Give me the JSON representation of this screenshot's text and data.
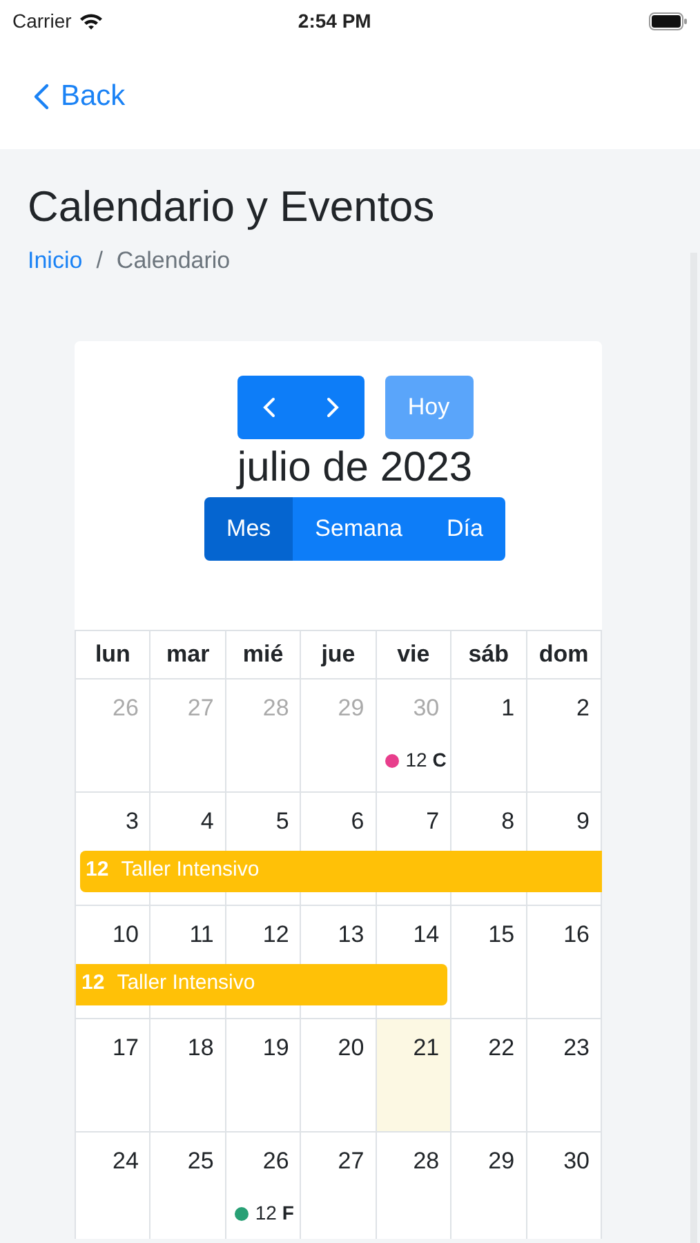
{
  "status_bar": {
    "carrier": "Carrier",
    "time": "2:54 PM"
  },
  "nav": {
    "back": "Back"
  },
  "page": {
    "title": "Calendario y Eventos",
    "breadcrumb": {
      "separator": "/",
      "items": [
        {
          "label": "Inicio",
          "kind": "link"
        },
        {
          "label": "Calendario",
          "kind": "current"
        }
      ]
    }
  },
  "calendar": {
    "title": "julio de 2023",
    "today_button": {
      "label": "Hoy",
      "disabled": true
    },
    "views": [
      {
        "label": "Mes",
        "selected": true
      },
      {
        "label": "Semana",
        "selected": false
      },
      {
        "label": "Día",
        "selected": false
      }
    ],
    "weekdays": [
      "lun",
      "mar",
      "mié",
      "jue",
      "vie",
      "sáb",
      "dom"
    ],
    "weeks": [
      {
        "days": [
          {
            "label": "26",
            "muted": true,
            "today": false
          },
          {
            "label": "27",
            "muted": true,
            "today": false
          },
          {
            "label": "28",
            "muted": true,
            "today": false
          },
          {
            "label": "29",
            "muted": true,
            "today": false
          },
          {
            "label": "30",
            "muted": true,
            "today": false,
            "event": {
              "time": "12",
              "title": "C",
              "color": "#e83e8c"
            }
          },
          {
            "label": "1",
            "muted": false,
            "today": false
          },
          {
            "label": "2",
            "muted": false,
            "today": false
          }
        ]
      },
      {
        "days": [
          {
            "label": "3",
            "muted": false,
            "today": false,
            "in_bar": true,
            "bar_event": {
              "time": "12",
              "title": "Taller Intensivo",
              "color": "#ffc107"
            }
          },
          {
            "label": "4",
            "muted": false,
            "today": false,
            "in_bar": true
          },
          {
            "label": "5",
            "muted": false,
            "today": false,
            "in_bar": true
          },
          {
            "label": "6",
            "muted": false,
            "today": false,
            "in_bar": true
          },
          {
            "label": "7",
            "muted": false,
            "today": false,
            "in_bar": true
          },
          {
            "label": "8",
            "muted": false,
            "today": false,
            "in_bar": true
          },
          {
            "label": "9",
            "muted": false,
            "today": false,
            "in_bar": true
          }
        ]
      },
      {
        "days": [
          {
            "label": "10",
            "muted": false,
            "today": false,
            "in_bar": true,
            "bar_event": {
              "time": "12",
              "title": "Taller Intensivo",
              "color": "#ffc107"
            }
          },
          {
            "label": "11",
            "muted": false,
            "today": false,
            "in_bar": true
          },
          {
            "label": "12",
            "muted": false,
            "today": false,
            "in_bar": true
          },
          {
            "label": "13",
            "muted": false,
            "today": false,
            "in_bar": true
          },
          {
            "label": "14",
            "muted": false,
            "today": false,
            "in_bar": true
          },
          {
            "label": "15",
            "muted": false,
            "today": false
          },
          {
            "label": "16",
            "muted": false,
            "today": false
          }
        ]
      },
      {
        "days": [
          {
            "label": "17",
            "muted": false,
            "today": false
          },
          {
            "label": "18",
            "muted": false,
            "today": false
          },
          {
            "label": "19",
            "muted": false,
            "today": false
          },
          {
            "label": "20",
            "muted": false,
            "today": false
          },
          {
            "label": "21",
            "muted": false,
            "today": true
          },
          {
            "label": "22",
            "muted": false,
            "today": false
          },
          {
            "label": "23",
            "muted": false,
            "today": false
          }
        ]
      },
      {
        "days": [
          {
            "label": "24",
            "muted": false,
            "today": false
          },
          {
            "label": "25",
            "muted": false,
            "today": false
          },
          {
            "label": "26",
            "muted": false,
            "today": false,
            "event": {
              "time": "12",
              "title": "F",
              "color": "#28a075"
            }
          },
          {
            "label": "27",
            "muted": false,
            "today": false
          },
          {
            "label": "28",
            "muted": false,
            "today": false
          },
          {
            "label": "29",
            "muted": false,
            "today": false
          },
          {
            "label": "30",
            "muted": false,
            "today": false
          }
        ]
      }
    ]
  }
}
